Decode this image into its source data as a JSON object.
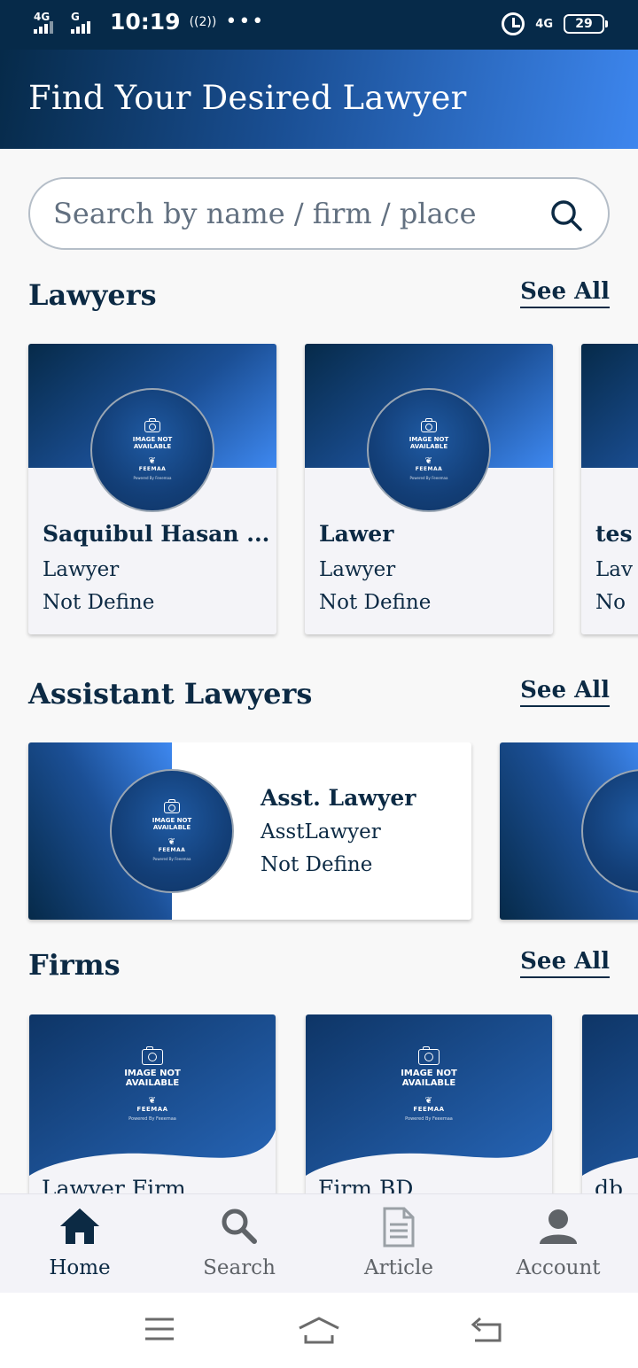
{
  "status_bar": {
    "sim1": "4G",
    "sim2": "G",
    "time": "10:19",
    "hotspot": "((2))",
    "more": "•••",
    "network": "4G",
    "battery": "29"
  },
  "header": {
    "title": "Find Your Desired Lawyer"
  },
  "search": {
    "placeholder": "Search by name / firm / place"
  },
  "placeholder_image": {
    "line1": "IMAGE NOT",
    "line2": "AVAILABLE",
    "logo": "FEEMAA",
    "powered": "Powered By Feeemaa"
  },
  "sections": {
    "lawyers": {
      "title": "Lawyers",
      "see_all": "See All",
      "items": [
        {
          "name": "Saquibul Hasan ...",
          "role": "Lawyer",
          "location": "Not Define"
        },
        {
          "name": "Lawer",
          "role": "Lawyer",
          "location": "Not Define"
        },
        {
          "name": "tes",
          "role": "Lav",
          "location": "No"
        }
      ]
    },
    "assistant_lawyers": {
      "title": "Assistant Lawyers",
      "see_all": "See All",
      "items": [
        {
          "name": "Asst. Lawyer",
          "role": "AsstLawyer",
          "location": "Not Define"
        }
      ]
    },
    "firms": {
      "title": "Firms",
      "see_all": "See All",
      "items": [
        {
          "name": "Lawyer Firm"
        },
        {
          "name": "Firm BD"
        },
        {
          "name": "db"
        }
      ]
    }
  },
  "bottom_nav": {
    "items": [
      {
        "label": "Home",
        "icon": "home-icon",
        "active": true
      },
      {
        "label": "Search",
        "icon": "search-icon",
        "active": false
      },
      {
        "label": "Article",
        "icon": "article-icon",
        "active": false
      },
      {
        "label": "Account",
        "icon": "account-icon",
        "active": false
      }
    ]
  },
  "colors": {
    "primary_dark": "#062a49",
    "primary_light": "#3e88f0",
    "text": "#0c2a44",
    "muted": "#5f6368"
  }
}
